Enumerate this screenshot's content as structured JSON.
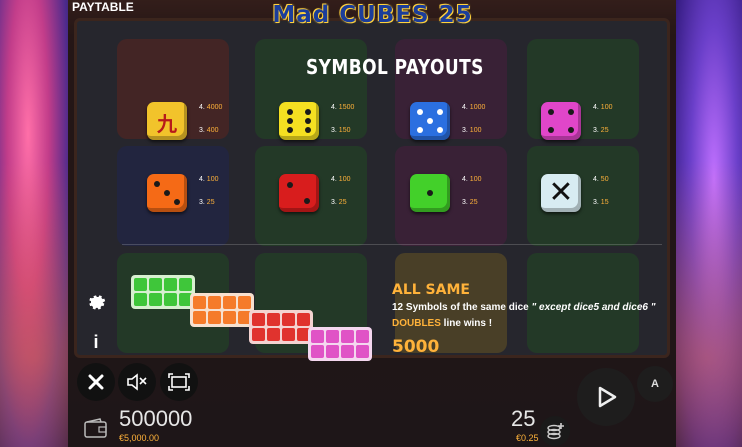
{
  "header": {
    "paytable_label": "PAYTABLE",
    "logo_text": "Mad CUBES 25"
  },
  "heading": "SYMBOL PAYOUTS",
  "payouts": [
    {
      "name": "kanji-nine-dice",
      "color": "#f2c32b",
      "glyph": "九",
      "lines": [
        {
          "count": "4.",
          "amount": "4000"
        },
        {
          "count": "3.",
          "amount": "400"
        }
      ]
    },
    {
      "name": "yellow-dice",
      "color": "#f5e021",
      "glyph": "",
      "lines": [
        {
          "count": "4.",
          "amount": "1500"
        },
        {
          "count": "3.",
          "amount": "150"
        }
      ]
    },
    {
      "name": "blue-dice",
      "color": "#2b6fe0",
      "glyph": "",
      "lines": [
        {
          "count": "4.",
          "amount": "1000"
        },
        {
          "count": "3.",
          "amount": "100"
        }
      ]
    },
    {
      "name": "pink-dice",
      "color": "#e046c9",
      "glyph": "",
      "lines": [
        {
          "count": "4.",
          "amount": "100"
        },
        {
          "count": "3.",
          "amount": "25"
        }
      ]
    },
    {
      "name": "orange-dice",
      "color": "#f56a16",
      "glyph": "",
      "lines": [
        {
          "count": "4.",
          "amount": "100"
        },
        {
          "count": "3.",
          "amount": "25"
        }
      ]
    },
    {
      "name": "red-dice",
      "color": "#d81d1d",
      "glyph": "",
      "lines": [
        {
          "count": "4.",
          "amount": "100"
        },
        {
          "count": "3.",
          "amount": "25"
        }
      ]
    },
    {
      "name": "green-dice",
      "color": "#43d02a",
      "glyph": "",
      "lines": [
        {
          "count": "4.",
          "amount": "100"
        },
        {
          "count": "3.",
          "amount": "25"
        }
      ]
    },
    {
      "name": "white-x-dice",
      "color": "#d8ecf2",
      "glyph": "✕",
      "lines": [
        {
          "count": "4.",
          "amount": "50"
        },
        {
          "count": "3.",
          "amount": "15"
        }
      ]
    }
  ],
  "all_same": {
    "title": "ALL SAME",
    "desc_prefix": "12 Symbols of the same dice ",
    "desc_italic": "\" except dice5 and dice6 \"",
    "doubles_label": "DOUBLES",
    "doubles_suffix": " line wins !",
    "amount": "5000"
  },
  "examples": [
    {
      "color": "#3fc63a",
      "glyph": "▪"
    },
    {
      "color": "#f57b2a",
      "glyph": "▪"
    },
    {
      "color": "#e0332e",
      "glyph": "▪"
    },
    {
      "color": "#e053c6",
      "glyph": "▪"
    }
  ],
  "controls": {
    "settings_icon": "gear-icon",
    "info_icon": "info-icon",
    "close_icon": "close-icon",
    "sound_icon": "sound-off-icon",
    "fullscreen_icon": "fullscreen-icon",
    "play_icon": "play-icon",
    "auto_icon": "autoplay-icon",
    "auto_label": "A"
  },
  "footer": {
    "balance": "500000",
    "balance_money": "€5,000.00",
    "bet": "25",
    "bet_money": "€0.25"
  },
  "colors": {
    "accent": "#ffb23a",
    "text": "#ffffff"
  }
}
